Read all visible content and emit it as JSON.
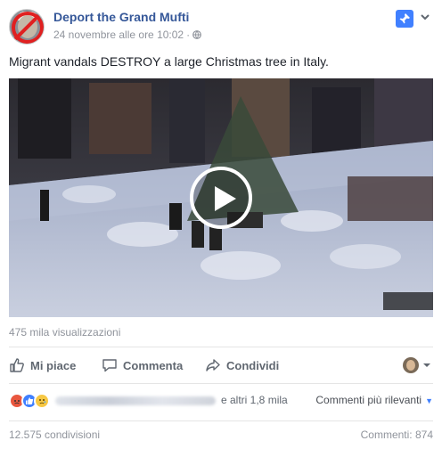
{
  "post": {
    "page_name": "Deport the Grand Mufti",
    "timestamp": "24 novembre alle ore 10:02",
    "separator": "·",
    "text": "Migrant vandals DESTROY a large Christmas tree in Italy.",
    "views": "475 mila visualizzazioni",
    "icons": [
      "banned-avatar",
      "globe-icon",
      "pin-icon",
      "caret-down-icon",
      "play-icon"
    ]
  },
  "actions": {
    "like_label": "Mi piace",
    "comment_label": "Commenta",
    "share_label": "Condividi"
  },
  "reactions": {
    "types": [
      "angry",
      "like",
      "sad"
    ],
    "others_text": "e altri 1,8 mila",
    "sort_label": "Commenti più rilevanti",
    "sort_arrow": "▼"
  },
  "footer": {
    "shares_text": "12.575 condivisioni",
    "comments_text": "Commenti: 874"
  },
  "colors": {
    "link": "#365899",
    "muted": "#90949c",
    "action": "#606770",
    "accent": "#4080ff",
    "angry": "#e9573f",
    "sad": "#f7c844"
  }
}
